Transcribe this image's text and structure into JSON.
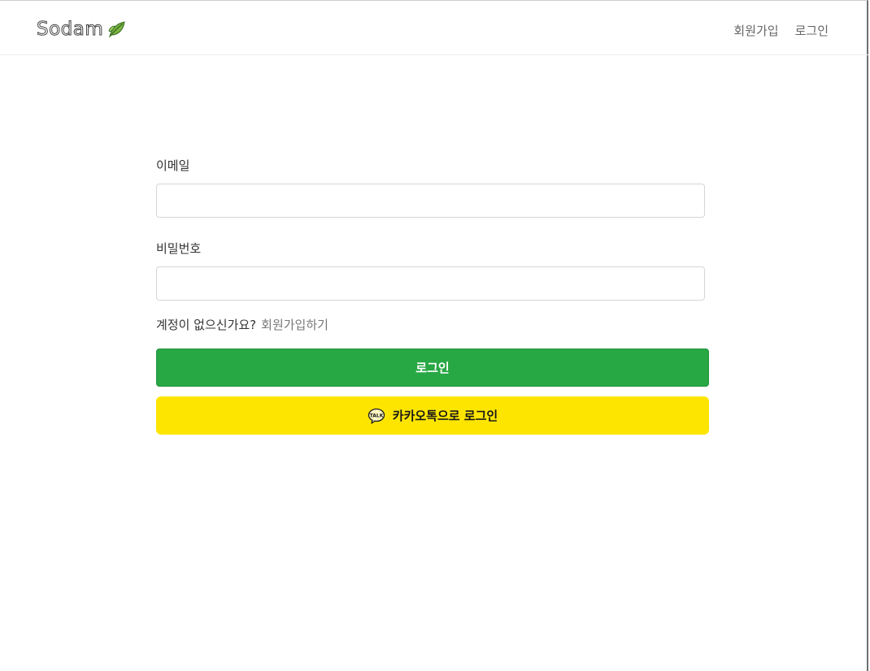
{
  "navbar": {
    "brand": "Sodam",
    "brand_icon": "leaf-icon",
    "links": [
      {
        "label": "회원가입"
      },
      {
        "label": "로그인"
      }
    ]
  },
  "form": {
    "email_label": "이메일",
    "email_value": "",
    "password_label": "비밀번호",
    "password_value": "",
    "signup_question": "계정이 없으신가요?",
    "signup_link": "회원가입하기",
    "login_button": "로그인",
    "kakao_button": "카카오톡으로 로그인",
    "kakao_icon": "kakao-talk-icon"
  },
  "colors": {
    "login_button": "#28a745",
    "kakao_button": "#fee500"
  }
}
